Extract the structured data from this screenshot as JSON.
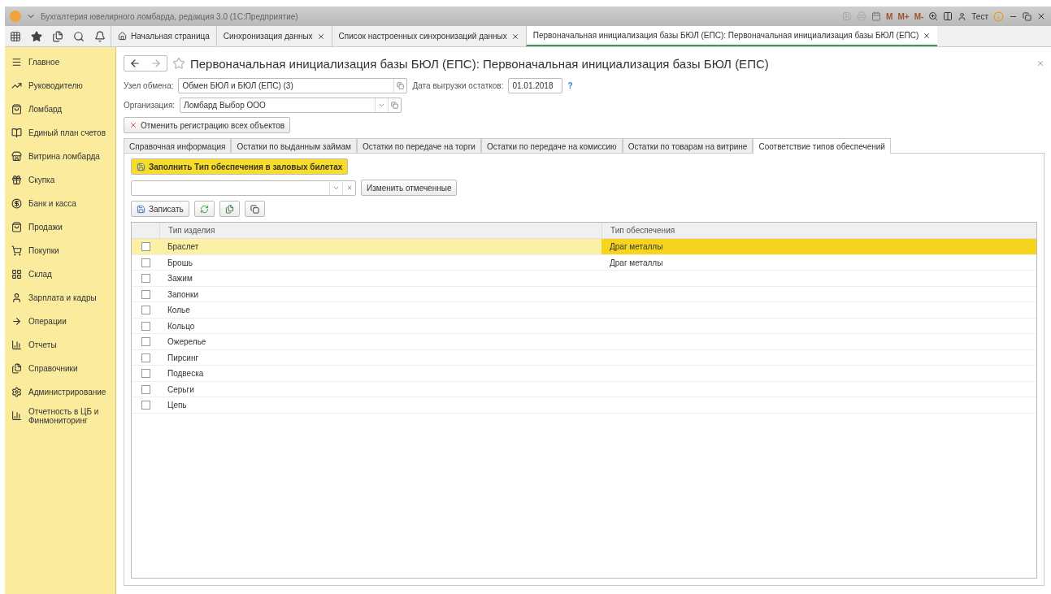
{
  "window": {
    "title": "Бухгалтерия ювелирного ломбарда, редакция 3.0  (1С:Предприятие)",
    "toolbar_texts": [
      "M",
      "M+",
      "M-"
    ],
    "user": "Тест"
  },
  "tabs": [
    {
      "label": "Начальная страница",
      "kind": "home",
      "selected": false
    },
    {
      "label": "Синхронизация данных",
      "kind": "page",
      "selected": false
    },
    {
      "label": "Список настроенных синхронизаций данных",
      "kind": "page",
      "selected": false
    },
    {
      "label": "Первоначальная инициализация базы БЮЛ (ЕПС): Первоначальная инициализация базы БЮЛ (ЕПС)",
      "kind": "page",
      "selected": true
    }
  ],
  "sidebar": {
    "items": [
      "Главное",
      "Руководителю",
      "Ломбард",
      "Единый план счетов",
      "Витрина ломбарда",
      "Скупка",
      "Банк и касса",
      "Продажи",
      "Покупки",
      "Склад",
      "Зарплата и кадры",
      "Операции",
      "Отчеты",
      "Справочники",
      "Администрирование",
      "Отчетность в ЦБ и Финмониторинг"
    ]
  },
  "form": {
    "title": "Первоначальная инициализация базы БЮЛ (ЕПС): Первоначальная инициализация базы БЮЛ (ЕПС)",
    "node_label": "Узел обмена:",
    "node_value": "Обмен БЮЛ и БЮЛ (ЕПС) (3)",
    "date_label": "Дата выгрузки остатков:",
    "date_value": "01.01.2018",
    "help": "?",
    "org_label": "Организация:",
    "org_value": "Ломбард Выбор ООО",
    "cancel_button": "Отменить регистрацию всех объектов",
    "tabs": [
      {
        "label": "Справочная информация",
        "selected": false
      },
      {
        "label": "Остатки по выданным займам",
        "selected": false
      },
      {
        "label": "Остатки по передаче на торги",
        "selected": false
      },
      {
        "label": "Остатки по передаче на комиссию",
        "selected": false
      },
      {
        "label": "Остатки по товарам на витрине",
        "selected": false
      },
      {
        "label": "Соответствие типов обеспечений",
        "selected": true
      }
    ],
    "fill_button": "Заполнить Тип обеспечения в заловых билетах",
    "change_button": "Изменить отмеченные",
    "save_button": "Записать"
  },
  "table": {
    "columns": [
      "Тип изделия",
      "Тип обеспечения"
    ],
    "rows": [
      {
        "item": "Браслет",
        "security": "Драг металлы",
        "checked": false,
        "selected": true
      },
      {
        "item": "Брошь",
        "security": "Драг металлы",
        "checked": false,
        "selected": false
      },
      {
        "item": "Зажим",
        "checked": false,
        "selected": false
      },
      {
        "item": "Запонки",
        "checked": false,
        "selected": false
      },
      {
        "item": "Колье",
        "checked": false,
        "selected": false
      },
      {
        "item": "Кольцо",
        "checked": false,
        "selected": false
      },
      {
        "item": "Ожерелье",
        "checked": false,
        "selected": false
      },
      {
        "item": "Пирсинг",
        "checked": false,
        "selected": false
      },
      {
        "item": "Подвеска",
        "checked": false,
        "selected": false
      },
      {
        "item": "Серьги",
        "checked": false,
        "selected": false
      },
      {
        "item": "Цепь",
        "checked": false,
        "selected": false
      }
    ]
  }
}
